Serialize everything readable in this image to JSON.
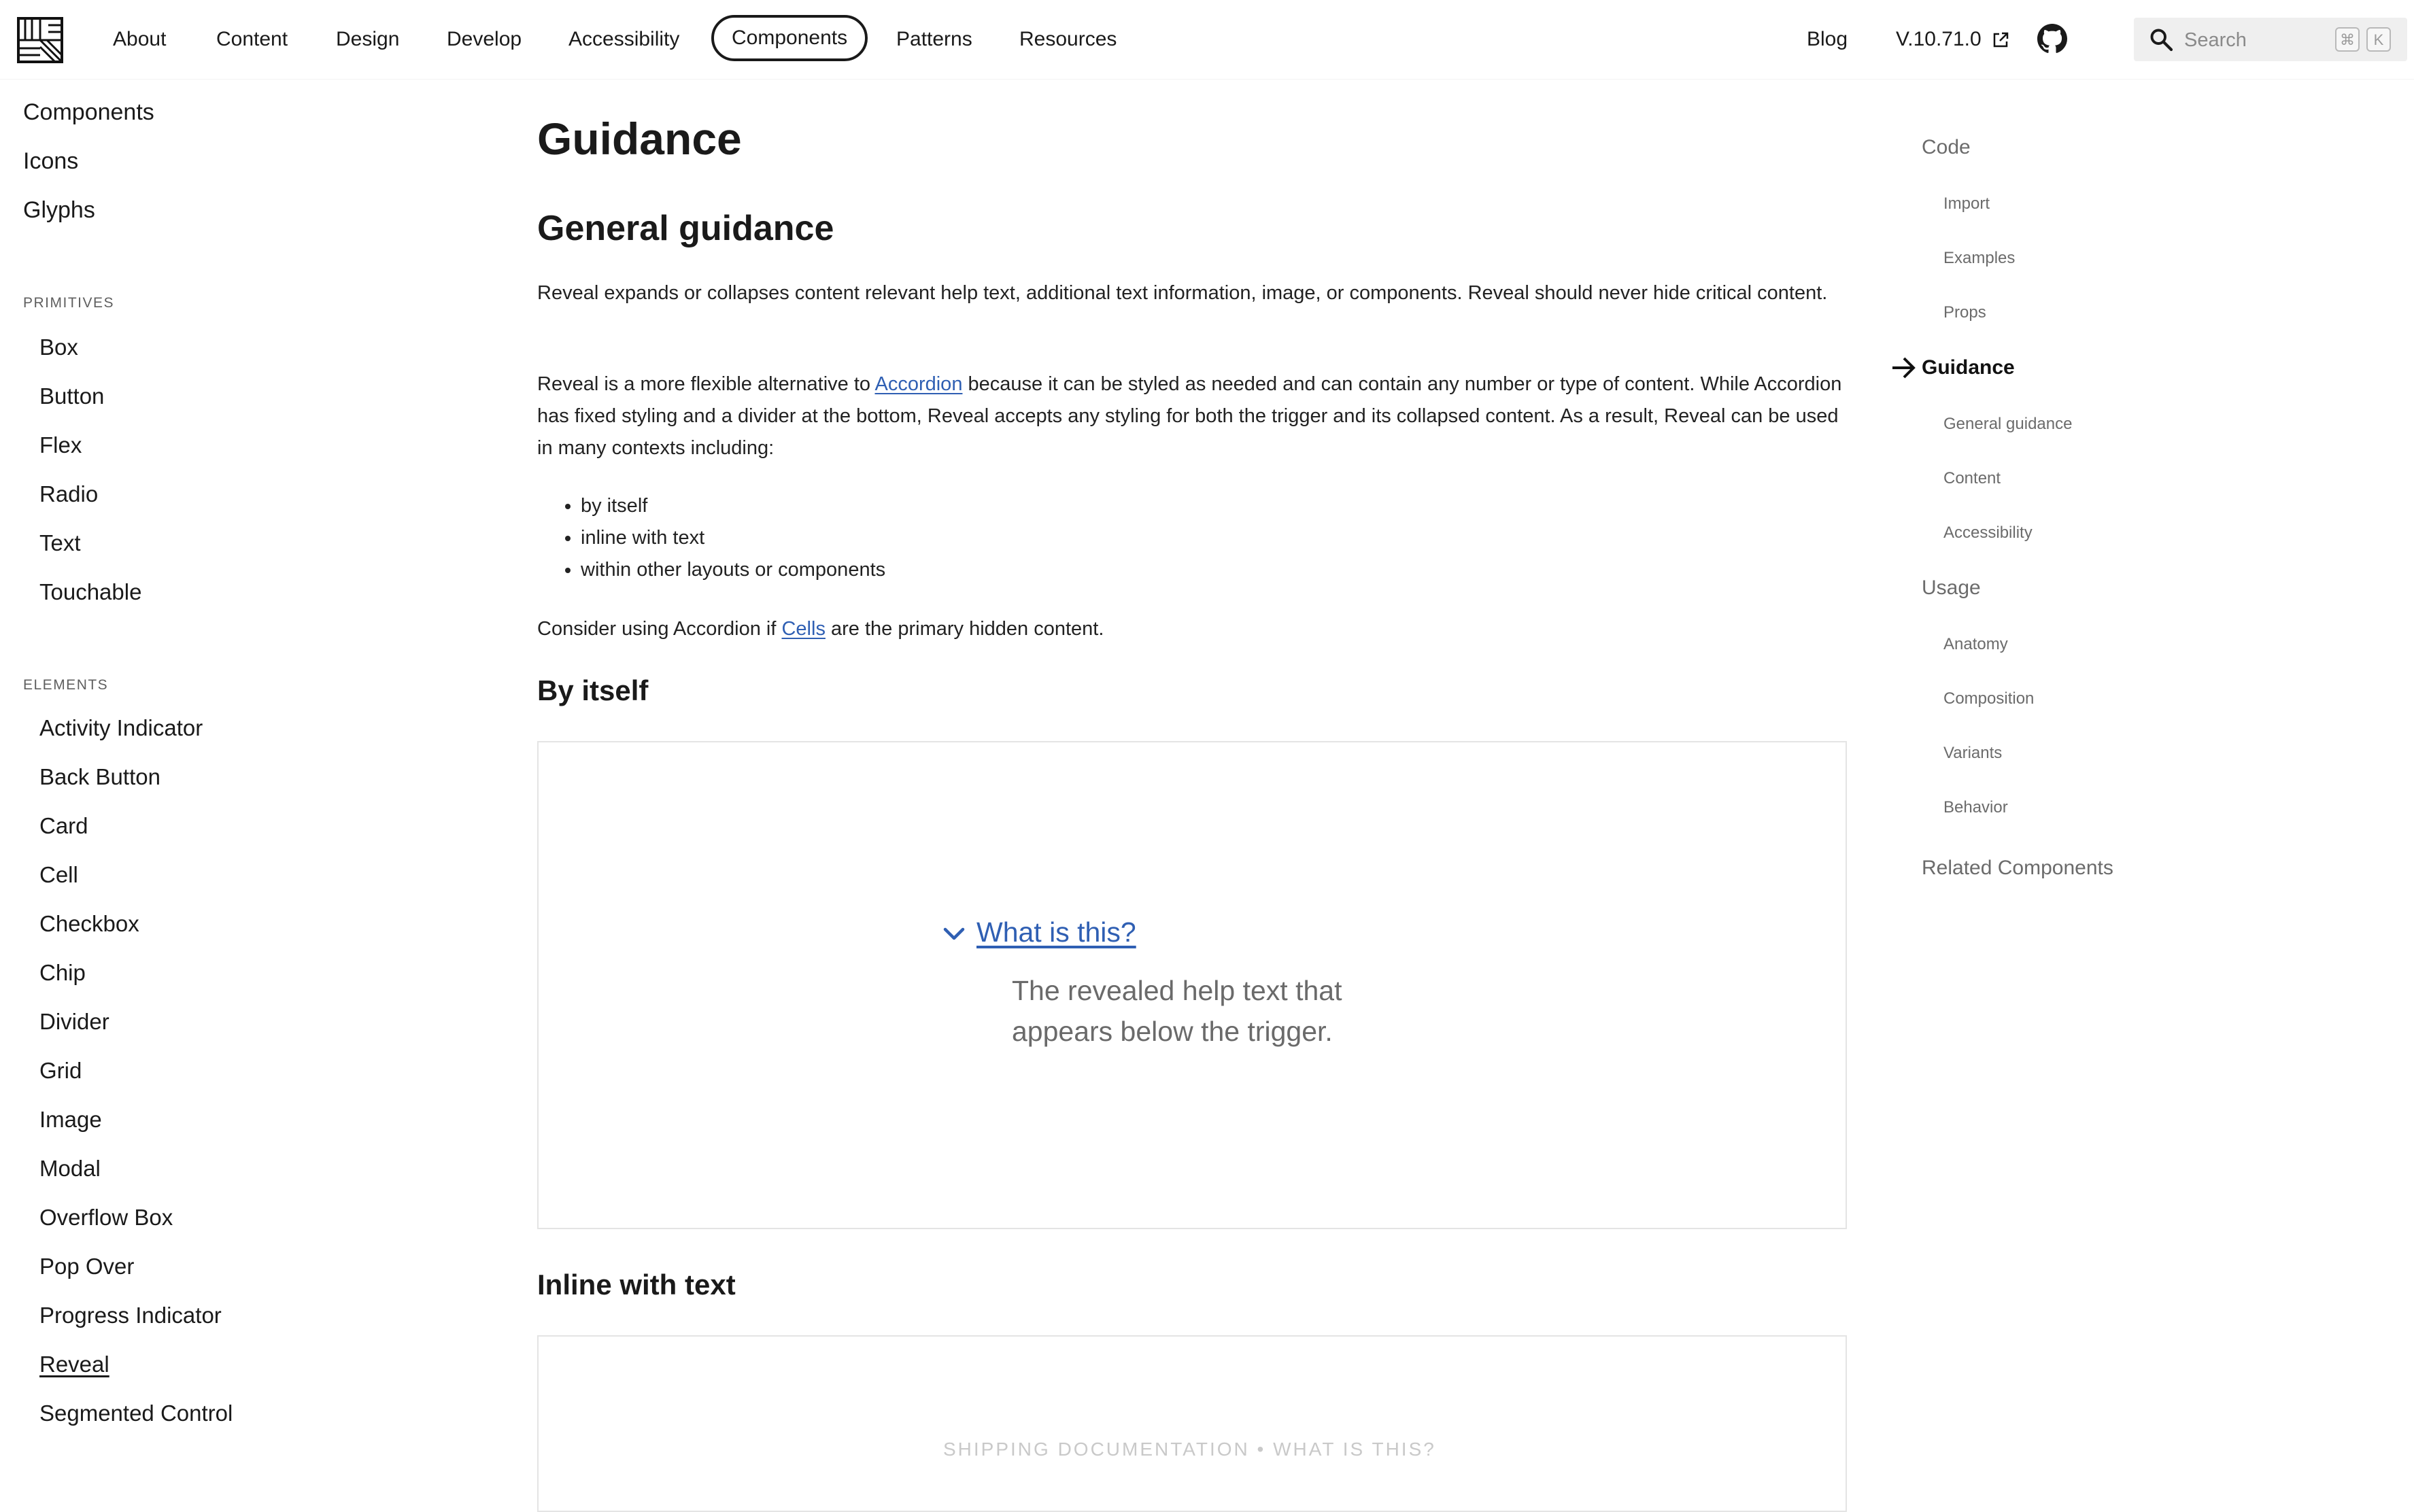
{
  "nav": {
    "items": [
      "About",
      "Content",
      "Design",
      "Develop",
      "Accessibility",
      "Components",
      "Patterns",
      "Resources"
    ],
    "active": "Components",
    "blog": "Blog",
    "version": "V.10.71.0",
    "github_icon": "github-icon",
    "search": {
      "placeholder": "Search",
      "shortcut_keys": [
        "⌘",
        "K"
      ]
    }
  },
  "sidebar": {
    "top_items": [
      "Components",
      "Icons",
      "Glyphs"
    ],
    "primitives_heading": "PRIMITIVES",
    "primitives": [
      "Box",
      "Button",
      "Flex",
      "Radio",
      "Text",
      "Touchable"
    ],
    "elements_heading": "ELEMENTS",
    "elements": [
      "Activity Indicator",
      "Back Button",
      "Card",
      "Cell",
      "Checkbox",
      "Chip",
      "Divider",
      "Grid",
      "Image",
      "Modal",
      "Overflow Box",
      "Pop Over",
      "Progress Indicator",
      "Reveal",
      "Segmented Control"
    ],
    "current": "Reveal"
  },
  "main": {
    "title": "Guidance",
    "general_heading": "General guidance",
    "p1": "Reveal expands or collapses content relevant help text, additional text information, image, or components. Reveal should never hide critical content.",
    "p2_before": "Reveal is a more flexible alternative to ",
    "p2_link": "Accordion",
    "p2_after": " because it can be styled as needed and can contain any number or type of content. While Accordion has fixed styling and a divider at the bottom, Reveal accepts any styling for both the trigger and its collapsed content. As a result, Reveal can be used in many contexts including:",
    "bullets": [
      "by itself",
      "inline with text",
      "within other layouts or components"
    ],
    "p3_before": "Consider using Accordion if ",
    "p3_link": "Cells",
    "p3_after": " are the primary hidden content.",
    "by_itself_heading": "By itself",
    "example1": {
      "trigger": "What is this?",
      "content": "The revealed help text that appears below the trigger."
    },
    "inline_heading": "Inline with text",
    "example2": {
      "faded_text": "SHIPPING DOCUMENTATION • WHAT IS THIS?"
    }
  },
  "toc": {
    "items": [
      {
        "label": "Code",
        "level": 1
      },
      {
        "label": "Import",
        "level": 2
      },
      {
        "label": "Examples",
        "level": 2
      },
      {
        "label": "Props",
        "level": 2
      },
      {
        "label": "Guidance",
        "level": 1,
        "active": true
      },
      {
        "label": "General guidance",
        "level": 2
      },
      {
        "label": "Content",
        "level": 2
      },
      {
        "label": "Accessibility",
        "level": 2
      },
      {
        "label": "Usage",
        "level": 1
      },
      {
        "label": "Anatomy",
        "level": 2
      },
      {
        "label": "Composition",
        "level": 2
      },
      {
        "label": "Variants",
        "level": 2
      },
      {
        "label": "Behavior",
        "level": 2
      },
      {
        "label": "Related Components",
        "level": 1
      }
    ]
  },
  "colors": {
    "link": "#2f5fb3",
    "text": "#1a1a1a",
    "muted": "#6b6b6b",
    "search_bg": "#efefef"
  }
}
